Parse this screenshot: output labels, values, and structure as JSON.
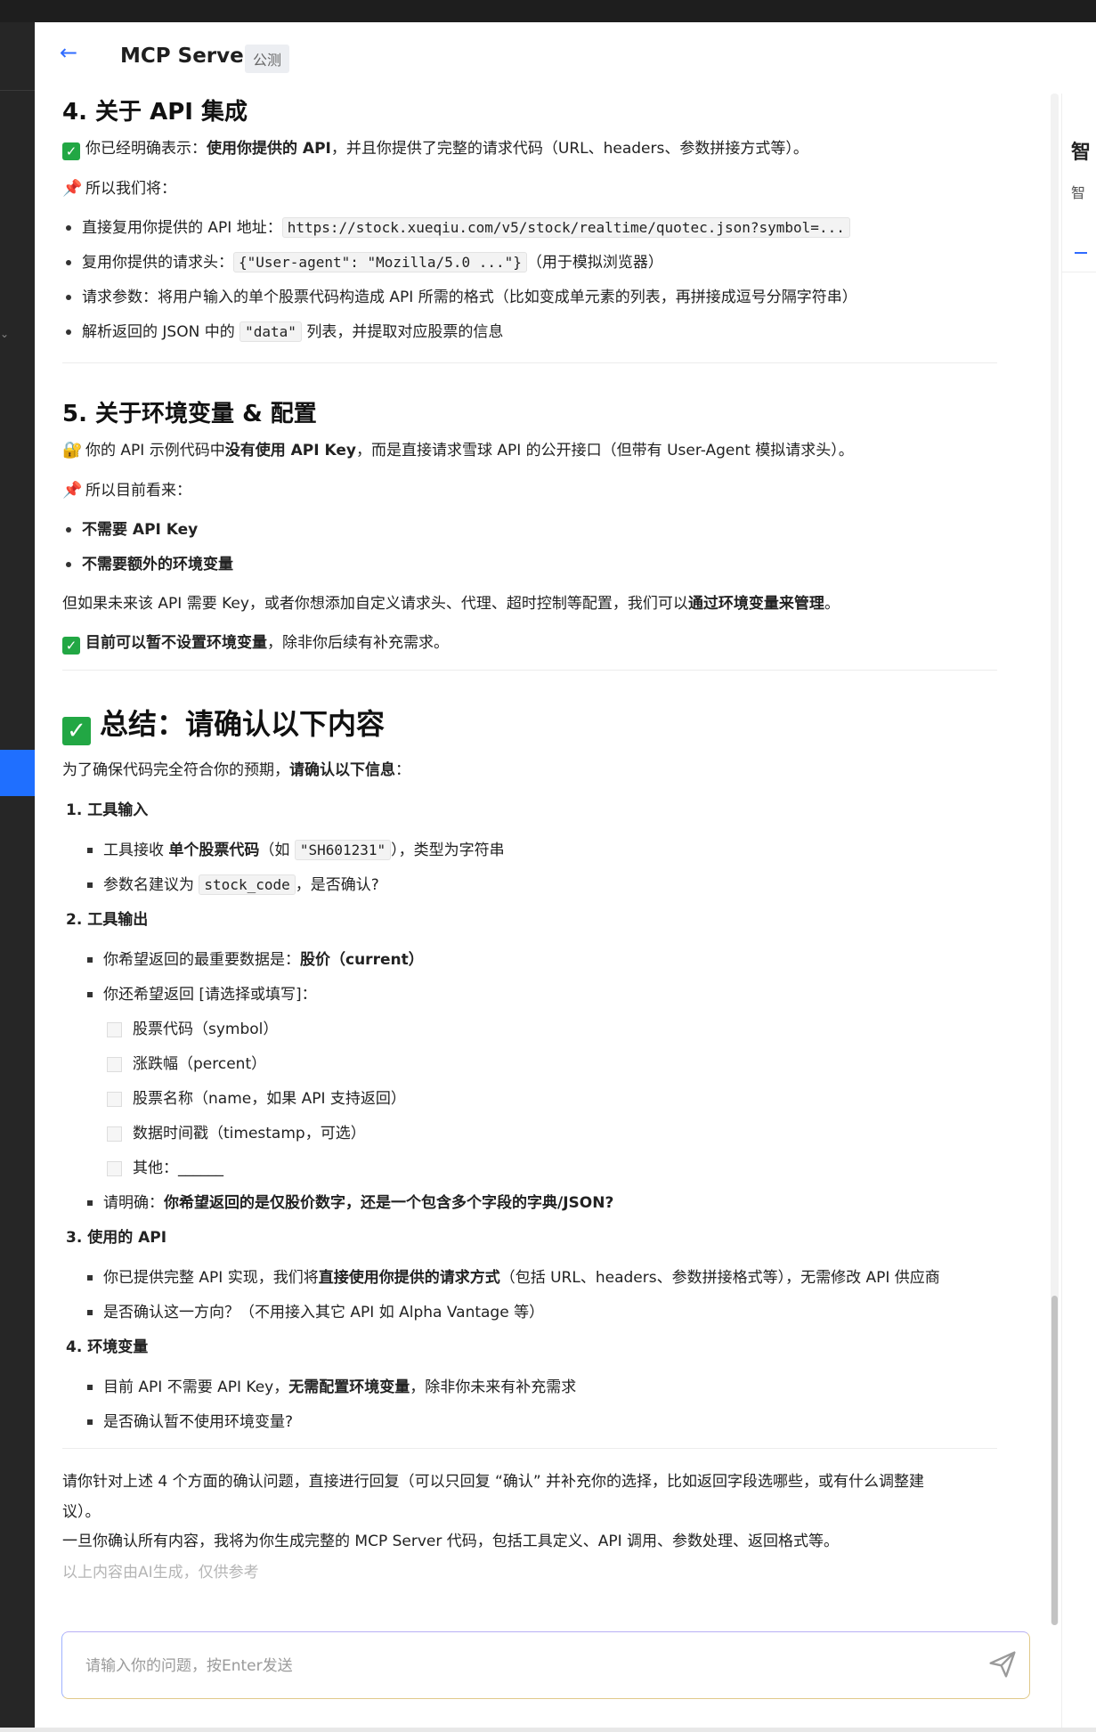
{
  "header": {
    "title": "MCP Server",
    "badge": "公测"
  },
  "sec4": {
    "heading": "4. 关于 API 集成",
    "p1_a": "你已经明确表示：",
    "p1_b": "使用你提供的 API",
    "p1_c": "，并且你提供了完整的请求代码（URL、headers、参数拼接方式等）。",
    "p2": "所以我们将：",
    "b1_a": "直接复用你提供的 API 地址：",
    "b1_code": "https://stock.xueqiu.com/v5/stock/realtime/quotec.json?symbol=...",
    "b2_a": "复用你提供的请求头：",
    "b2_code": "{\"User-agent\": \"Mozilla/5.0 ...\"}",
    "b2_c": "（用于模拟浏览器）",
    "b3": "请求参数：将用户输入的单个股票代码构造成 API 所需的格式（比如变成单元素的列表，再拼接成逗号分隔字符串）",
    "b4_a": "解析返回的 JSON 中的",
    "b4_code": "\"data\"",
    "b4_c": "列表，并提取对应股票的信息"
  },
  "sec5": {
    "heading": "5. 关于环境变量 & 配置",
    "p1_a": "你的 API 示例代码中",
    "p1_b": "没有使用 API Key",
    "p1_c": "，而是直接请求雪球 API 的公开接口（但带有 User-Agent 模拟请求头）。",
    "p2": "所以目前看来：",
    "b1": "不需要 API Key",
    "b2": "不需要额外的环境变量",
    "p3_a": "但如果未来该 API 需要 Key，或者你想添加自定义请求头、代理、超时控制等配置，我们可以",
    "p3_b": "通过环境变量来管理",
    "p3_c": "。",
    "p4_a": "目前可以暂不设置环境变量",
    "p4_b": "，除非你后续有补充需求。"
  },
  "summary": {
    "heading": "总结：请确认以下内容",
    "intro_a": "为了确保代码完全符合你的预期，",
    "intro_b": "请确认以下信息",
    "intro_c": "：",
    "i1": "1. 工具输入",
    "i1_b1_a": "工具接收",
    "i1_b1_b": "单个股票代码",
    "i1_b1_c": "（如",
    "i1_b1_code": "\"SH601231\"",
    "i1_b1_d": "），类型为字符串",
    "i1_b2_a": "参数名建议为",
    "i1_b2_code": "stock_code",
    "i1_b2_c": "，是否确认?",
    "i2": "2. 工具输出",
    "i2_b1_a": "你希望返回的最重要数据是：",
    "i2_b1_b": "股价（current）",
    "i2_b2": "你还希望返回 [请选择或填写]：",
    "opts": [
      "股票代码（symbol）",
      "涨跌幅（percent）",
      "股票名称（name，如果 API 支持返回）",
      "数据时间戳（timestamp，可选）",
      "其他：______"
    ],
    "i2_b3_a": "请明确：",
    "i2_b3_b": "你希望返回的是仅股价数字，还是一个包含多个字段的字典/JSON?",
    "i3": "3. 使用的 API",
    "i3_b1_a": "你已提供完整 API 实现，我们将",
    "i3_b1_b": "直接使用你提供的请求方式",
    "i3_b1_c": "（包括 URL、headers、参数拼接格式等），无需修改 API 供应商",
    "i3_b2": "是否确认这一方向？（不用接入其它 API 如 Alpha Vantage 等）",
    "i4": "4. 环境变量",
    "i4_b1_a": "目前 API 不需要 API Key，",
    "i4_b1_b": "无需配置环境变量",
    "i4_b1_c": "，除非你未来有补充需求",
    "i4_b2": "是否确认暂不使用环境变量?",
    "closing1": "请你针对上述 4 个方面的确认问题，直接进行回复（可以只回复 “确认” 并补充你的选择，比如返回字段选哪些，或有什么调整建",
    "closing1b": "议）。",
    "closing2": "一旦你确认所有内容，我将为你生成完整的 MCP Server 代码，包括工具定义、API 调用、参数处理、返回格式等。",
    "footnote": "以上内容由AI生成，仅供参考"
  },
  "input": {
    "placeholder": "请输入你的问题，按Enter发送"
  },
  "right": {
    "t1": "智",
    "t2": "智"
  },
  "icons": {
    "back": "arrow-left-icon",
    "send": "paper-plane-icon",
    "pin": "pushpin-icon",
    "check": "check-mark-icon",
    "lock": "lock-icon"
  }
}
